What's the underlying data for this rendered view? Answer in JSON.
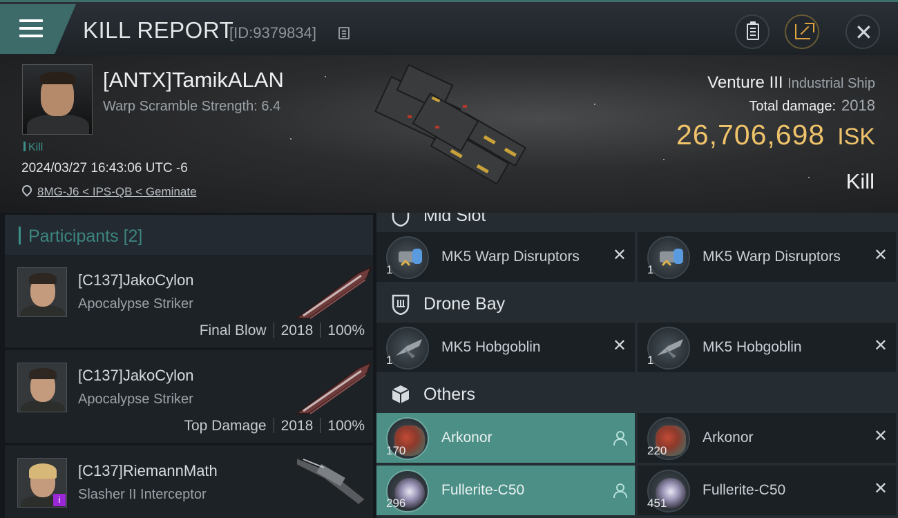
{
  "header": {
    "title": "KILL REPORT",
    "report_id": "[ID:9379834]"
  },
  "victim": {
    "name": "[ANTX]TamikALAN",
    "stat": "Warp Scramble Strength: 6.4",
    "tag": "Kill",
    "timestamp": "2024/03/27 16:43:06 UTC -6",
    "location": "8MG-J6 < IPS-QB < Geminate",
    "ship_name": "Venture III",
    "ship_class": "Industrial Ship",
    "total_damage_label": "Total damage:",
    "total_damage": "2018",
    "isk_value": "26,706,698",
    "isk_unit": "ISK",
    "result": "Kill"
  },
  "participants": {
    "title": "Participants",
    "count": "[2]",
    "rows": [
      {
        "name": "[C137]JakoCylon",
        "ship": "Apocalypse Striker",
        "role": "Final Blow",
        "damage": "2018",
        "percent": "100%"
      },
      {
        "name": "[C137]JakoCylon",
        "ship": "Apocalypse Striker",
        "role": "Top Damage",
        "damage": "2018",
        "percent": "100%"
      },
      {
        "name": "[C137]RiemannMath",
        "ship": "Slasher II Interceptor",
        "badge": "i"
      }
    ]
  },
  "fitting": {
    "mid_slot_label": "Mid Slot",
    "mid_slot": [
      {
        "qty": "1",
        "name": "MK5 Warp Disruptors"
      },
      {
        "qty": "1",
        "name": "MK5 Warp Disruptors"
      }
    ],
    "drone_bay_label": "Drone Bay",
    "drone_bay": [
      {
        "qty": "1",
        "name": "MK5  Hobgoblin"
      },
      {
        "qty": "1",
        "name": "MK5  Hobgoblin"
      }
    ],
    "others_label": "Others",
    "others": [
      {
        "qty": "170",
        "name": "Arkonor",
        "state": "dropped"
      },
      {
        "qty": "220",
        "name": "Arkonor",
        "state": "destroyed"
      },
      {
        "qty": "296",
        "name": "Fullerite-C50",
        "state": "dropped"
      },
      {
        "qty": "451",
        "name": "Fullerite-C50",
        "state": "destroyed"
      }
    ]
  },
  "colors": {
    "accent_teal": "#3d9089",
    "isk_gold": "#f0c36b",
    "highlight_row": "#4c8f86",
    "share_orange": "#e0a53e"
  }
}
